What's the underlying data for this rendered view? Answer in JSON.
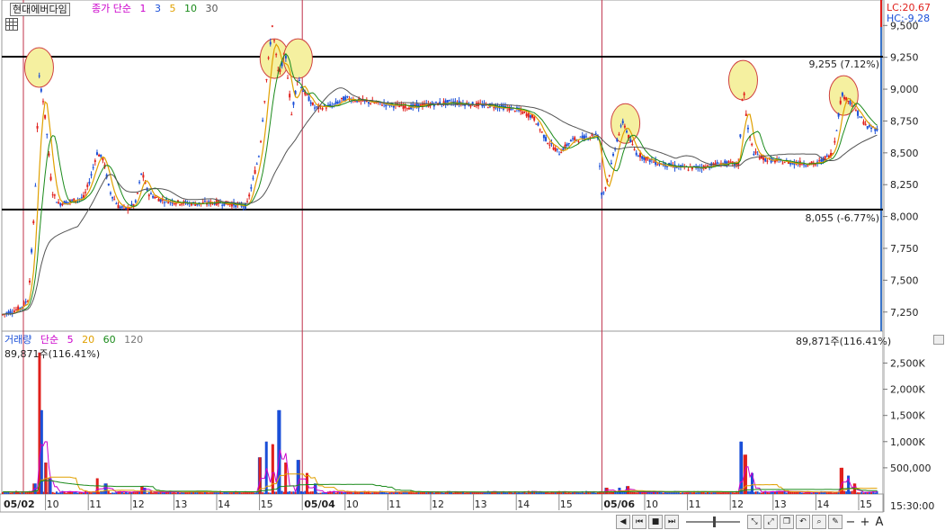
{
  "header": {
    "stock_name": "현대에버다임",
    "ma_title": "종가 단순",
    "ma_periods": [
      "1",
      "3",
      "5",
      "10",
      "30"
    ],
    "lc_label": "LC:20.67",
    "hc_label": "HC:-9.28"
  },
  "volume_header": {
    "title": "거래량",
    "ma_title": "단순",
    "ma_periods": [
      "5",
      "20",
      "60",
      "120"
    ],
    "left_value": "89,871주(116.41%)",
    "right_value": "89,871주(116.41%)"
  },
  "time_label": "15:30:00",
  "colors": {
    "up": "#e0201c",
    "down": "#1a4fd8",
    "ma1": "#cc00cc",
    "ma3": "#1a4fd8",
    "ma5": "#e0a000",
    "ma10": "#1a8a1a",
    "ma30": "#555555",
    "highlight": "#f5f0a0",
    "day_divider": "#c0304a"
  },
  "chart_data": [
    {
      "type": "line",
      "series_kind": "intraday price (candlestick, 1-min)",
      "price_axis": {
        "ylim": [
          7100,
          9700
        ],
        "ticks": [
          7250,
          7500,
          7750,
          8000,
          8250,
          8500,
          8750,
          9000,
          9250,
          9500
        ],
        "tick_labels": [
          "7,250",
          "7,500",
          "7,750",
          "8,000",
          "8,250",
          "8,500",
          "8,750",
          "9,000",
          "9,250",
          "9,500"
        ]
      },
      "x_labels": [
        {
          "label": "05/02",
          "slot": 0,
          "bold": true
        },
        {
          "label": "10",
          "slot": 1
        },
        {
          "label": "11",
          "slot": 2
        },
        {
          "label": "12",
          "slot": 3
        },
        {
          "label": "13",
          "slot": 4
        },
        {
          "label": "14",
          "slot": 5
        },
        {
          "label": "15",
          "slot": 6
        },
        {
          "label": "05/04",
          "slot": 7,
          "bold": true
        },
        {
          "label": "10",
          "slot": 8
        },
        {
          "label": "11",
          "slot": 9
        },
        {
          "label": "12",
          "slot": 10
        },
        {
          "label": "13",
          "slot": 11
        },
        {
          "label": "14",
          "slot": 12
        },
        {
          "label": "15",
          "slot": 13
        },
        {
          "label": "05/06",
          "slot": 14,
          "bold": true
        },
        {
          "label": "10",
          "slot": 15
        },
        {
          "label": "11",
          "slot": 16
        },
        {
          "label": "12",
          "slot": 17
        },
        {
          "label": "13",
          "slot": 18
        },
        {
          "label": "14",
          "slot": 19
        },
        {
          "label": "15",
          "slot": 20
        }
      ],
      "day_boundaries": [
        0,
        7,
        14
      ],
      "reference_lines": [
        {
          "value": 9255,
          "label": "9,255 (7.12%)"
        },
        {
          "value": 8055,
          "label": "8,055 (-6.77%)"
        }
      ],
      "price_path": [
        [
          0,
          7230
        ],
        [
          0.4,
          7280
        ],
        [
          0.6,
          7350
        ],
        [
          0.75,
          8100
        ],
        [
          0.85,
          9100
        ],
        [
          0.95,
          8900
        ],
        [
          1.05,
          8600
        ],
        [
          1.15,
          8200
        ],
        [
          1.3,
          8100
        ],
        [
          1.6,
          8120
        ],
        [
          1.9,
          8150
        ],
        [
          2.05,
          8300
        ],
        [
          2.2,
          8500
        ],
        [
          2.35,
          8450
        ],
        [
          2.5,
          8200
        ],
        [
          2.7,
          8080
        ],
        [
          2.9,
          8060
        ],
        [
          3.1,
          8100
        ],
        [
          3.25,
          8350
        ],
        [
          3.4,
          8180
        ],
        [
          3.7,
          8130
        ],
        [
          4.1,
          8110
        ],
        [
          4.5,
          8100
        ],
        [
          5.0,
          8110
        ],
        [
          5.3,
          8100
        ],
        [
          5.7,
          8080
        ],
        [
          6.0,
          8500
        ],
        [
          6.2,
          9200
        ],
        [
          6.3,
          9500
        ],
        [
          6.45,
          9100
        ],
        [
          6.6,
          9300
        ],
        [
          6.75,
          8800
        ],
        [
          6.9,
          9100
        ],
        [
          7.0,
          9000
        ],
        [
          7.3,
          8850
        ],
        [
          7.7,
          8870
        ],
        [
          8.0,
          8930
        ],
        [
          8.5,
          8900
        ],
        [
          9.0,
          8880
        ],
        [
          9.5,
          8860
        ],
        [
          10.0,
          8880
        ],
        [
          10.5,
          8900
        ],
        [
          11.0,
          8880
        ],
        [
          11.5,
          8870
        ],
        [
          12.0,
          8840
        ],
        [
          12.4,
          8780
        ],
        [
          12.7,
          8600
        ],
        [
          13.0,
          8500
        ],
        [
          13.3,
          8600
        ],
        [
          13.6,
          8620
        ],
        [
          13.9,
          8650
        ],
        [
          14.0,
          8150
        ],
        [
          14.15,
          8300
        ],
        [
          14.35,
          8600
        ],
        [
          14.5,
          8750
        ],
        [
          14.65,
          8600
        ],
        [
          14.8,
          8500
        ],
        [
          15.0,
          8460
        ],
        [
          15.3,
          8420
        ],
        [
          15.6,
          8400
        ],
        [
          16.0,
          8380
        ],
        [
          16.4,
          8390
        ],
        [
          16.8,
          8420
        ],
        [
          17.2,
          8410
        ],
        [
          17.3,
          9050
        ],
        [
          17.4,
          8700
        ],
        [
          17.55,
          8500
        ],
        [
          17.8,
          8450
        ],
        [
          18.2,
          8430
        ],
        [
          18.6,
          8420
        ],
        [
          19.0,
          8410
        ],
        [
          19.4,
          8500
        ],
        [
          19.6,
          8960
        ],
        [
          19.8,
          8900
        ],
        [
          20.0,
          8800
        ],
        [
          20.2,
          8700
        ],
        [
          20.4,
          8690
        ]
      ],
      "highlight_circles": [
        {
          "slot": 0.85,
          "value": 9170
        },
        {
          "slot": 6.35,
          "value": 9240
        },
        {
          "slot": 6.9,
          "value": 9240
        },
        {
          "slot": 14.55,
          "value": 8730
        },
        {
          "slot": 17.3,
          "value": 9070
        },
        {
          "slot": 19.65,
          "value": 8950
        }
      ]
    },
    {
      "type": "bar",
      "series_kind": "volume",
      "volume_axis": {
        "ylim": [
          0,
          2800000
        ],
        "ticks": [
          500000,
          1000000,
          1500000,
          2000000,
          2500000
        ],
        "tick_labels": [
          "500,000",
          "1,000K",
          "1,500K",
          "2,000K",
          "2,500K"
        ]
      },
      "spikes": [
        [
          0.35,
          40000
        ],
        [
          0.75,
          200000
        ],
        [
          0.85,
          2700000
        ],
        [
          0.9,
          1600000
        ],
        [
          1.0,
          600000
        ],
        [
          1.1,
          300000
        ],
        [
          2.2,
          300000
        ],
        [
          2.4,
          200000
        ],
        [
          3.25,
          150000
        ],
        [
          3.3,
          120000
        ],
        [
          6.0,
          700000
        ],
        [
          6.15,
          1000000
        ],
        [
          6.3,
          950000
        ],
        [
          6.45,
          1600000
        ],
        [
          6.6,
          600000
        ],
        [
          6.9,
          650000
        ],
        [
          7.1,
          400000
        ],
        [
          7.3,
          200000
        ],
        [
          14.1,
          120000
        ],
        [
          14.4,
          120000
        ],
        [
          14.6,
          150000
        ],
        [
          17.25,
          1000000
        ],
        [
          17.35,
          750000
        ],
        [
          17.5,
          400000
        ],
        [
          19.6,
          500000
        ],
        [
          19.75,
          350000
        ],
        [
          19.9,
          200000
        ]
      ]
    }
  ]
}
